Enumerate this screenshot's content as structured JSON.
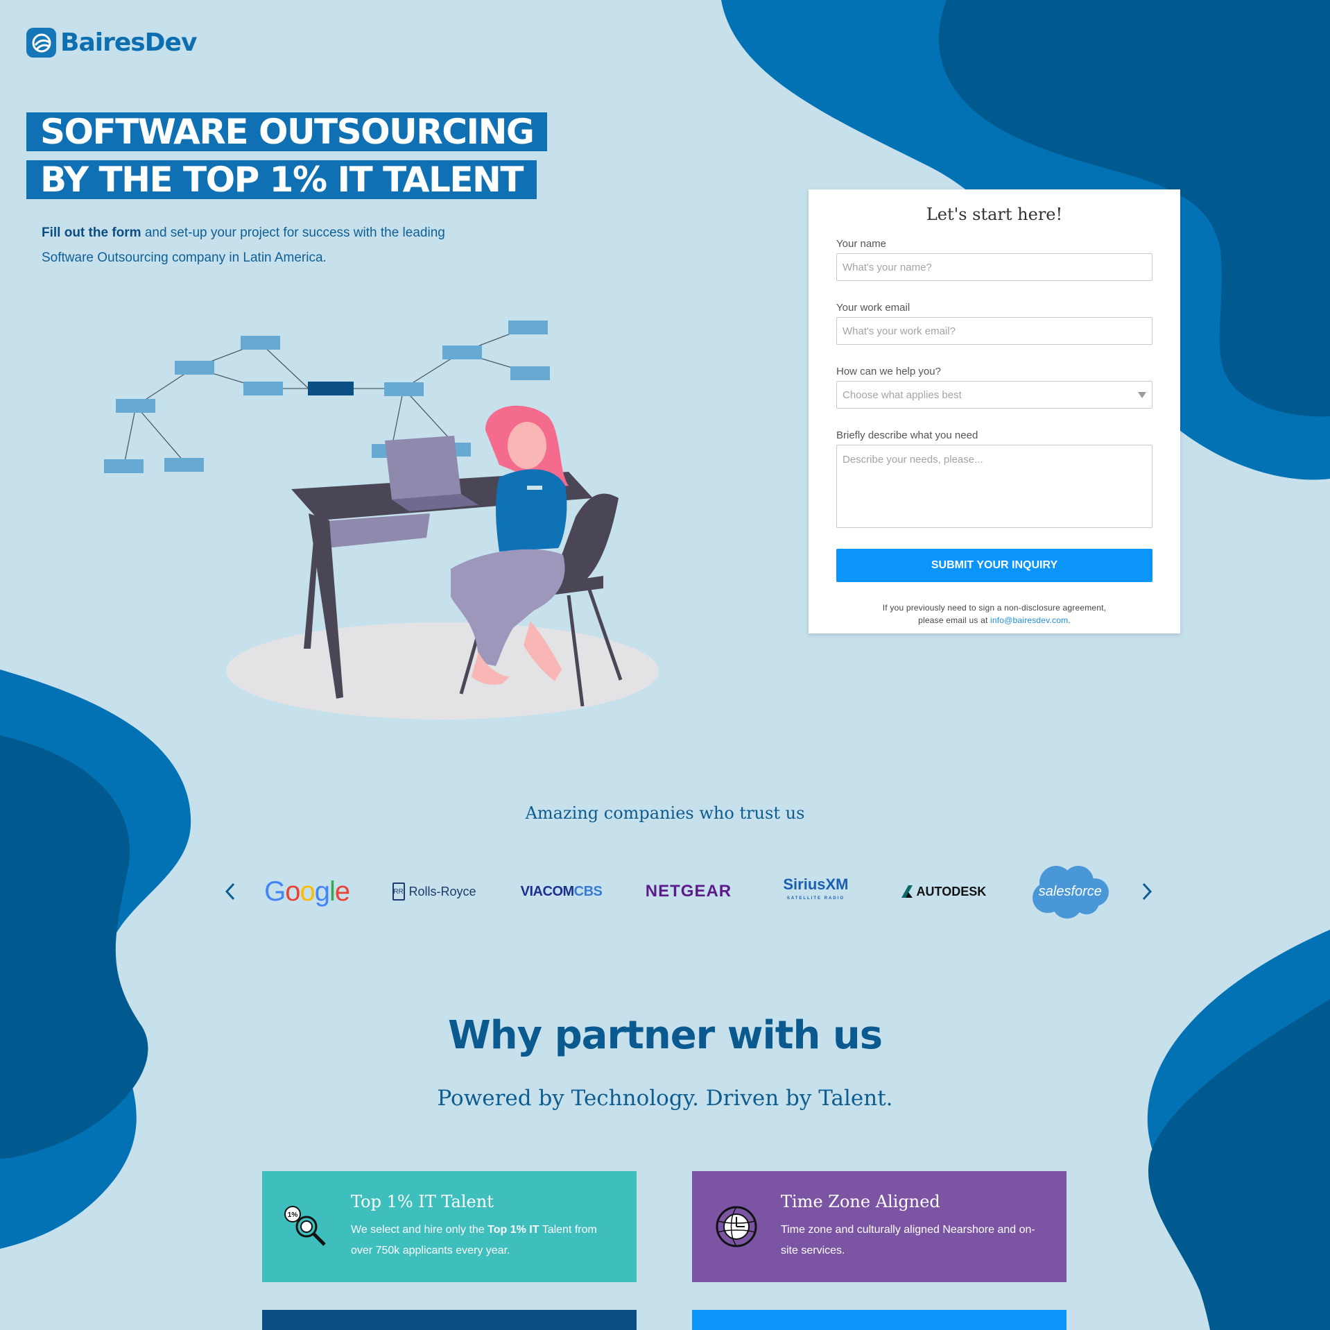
{
  "brand": {
    "name": "BairesDev",
    "color": "#0d6fb0"
  },
  "hero": {
    "line1": "SOFTWARE OUTSOURCING",
    "line2": "BY THE TOP 1% IT TALENT",
    "sub_bold": "Fill out the form",
    "sub_rest": " and set-up your project for success with the leading Software Outsourcing company in Latin America."
  },
  "form": {
    "title": "Let's start here!",
    "name_label": "Your name",
    "name_placeholder": "What's your name?",
    "email_label": "Your work email",
    "email_placeholder": "What's your work email?",
    "help_label": "How can we help you?",
    "help_selected": "Choose what applies best",
    "describe_label": "Briefly describe what you need",
    "describe_placeholder": "Describe your needs, please...",
    "submit_label": "SUBMIT YOUR INQUIRY",
    "nda_text_1": "If you previously need to sign a non-disclosure agreement,",
    "nda_text_2": "please email us at ",
    "nda_email": "info@bairesdev.com",
    "nda_period": "."
  },
  "trust": {
    "title": "Amazing companies who trust us",
    "logos": [
      "Google",
      "Rolls-Royce",
      "VIACOMCBS",
      "NETGEAR",
      "SiriusXM",
      "AUTODESK",
      "salesforce"
    ],
    "viacom_a": "VIACOM",
    "viacom_b": "CBS",
    "sirius_sub": "SATELLITE RADIO",
    "rr_mark": "RR"
  },
  "why": {
    "title": "Why partner with us",
    "subtitle": "Powered by Technology. Driven by Talent.",
    "features": [
      {
        "title": "Top 1% IT Talent",
        "text_a": "We select and hire only the ",
        "text_bold": "Top 1% IT",
        "text_b": " Talent from over 750k applicants every year.",
        "icon_badge": "1%",
        "color": "#3ebfbd"
      },
      {
        "title": "Time Zone Aligned",
        "text": "Time zone and culturally aligned Nearshore and on-site services.",
        "color": "#7b55a4"
      }
    ]
  },
  "colors": {
    "bg": "#c6e0ec",
    "blob_dark": "#005a8f",
    "blob_mid": "#0372b5",
    "accent": "#0b95fb"
  }
}
